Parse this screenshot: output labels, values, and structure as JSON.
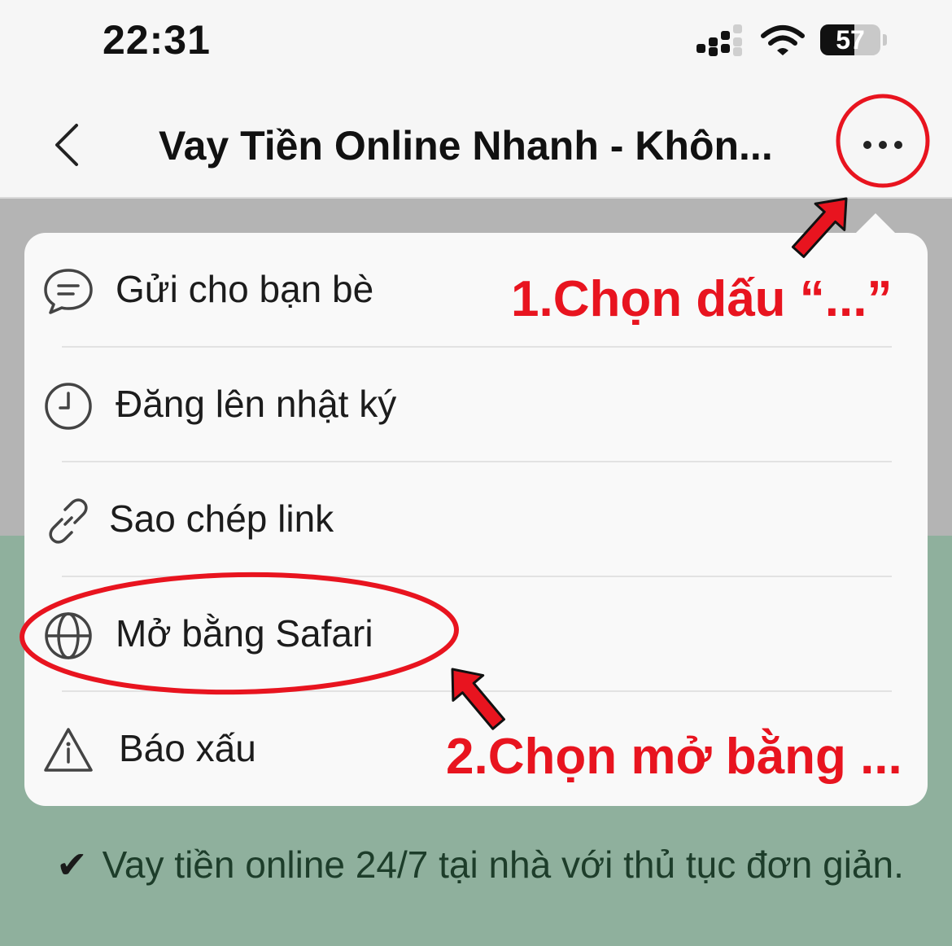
{
  "status_bar": {
    "time": "22:31",
    "battery_level": "57",
    "battery_percent": 57,
    "icons": [
      "signal-icon",
      "wifi-icon",
      "battery-icon"
    ]
  },
  "nav": {
    "title": "Vay Tiền Online Nhanh - Khôn...",
    "back_icon": "chevron-left-icon",
    "more_icon": "more-horizontal-icon"
  },
  "menu": {
    "items": [
      {
        "label": "Gửi cho bạn bè",
        "icon": "chat-bubble-icon"
      },
      {
        "label": "Đăng lên nhật ký",
        "icon": "clock-icon"
      },
      {
        "label": "Sao chép link",
        "icon": "link-icon"
      },
      {
        "label": "Mở bằng Safari",
        "icon": "globe-icon"
      },
      {
        "label": "Báo xấu",
        "icon": "warning-icon"
      }
    ]
  },
  "annotations": {
    "step1": "1.Chọn dấu “...”",
    "step2": "2.Chọn mở bằng ...",
    "color": "#e8141f"
  },
  "page": {
    "checkmark": "✔",
    "bottom_text": "Vay tiền online 24/7 tại nhà với thủ tục đơn giản."
  }
}
